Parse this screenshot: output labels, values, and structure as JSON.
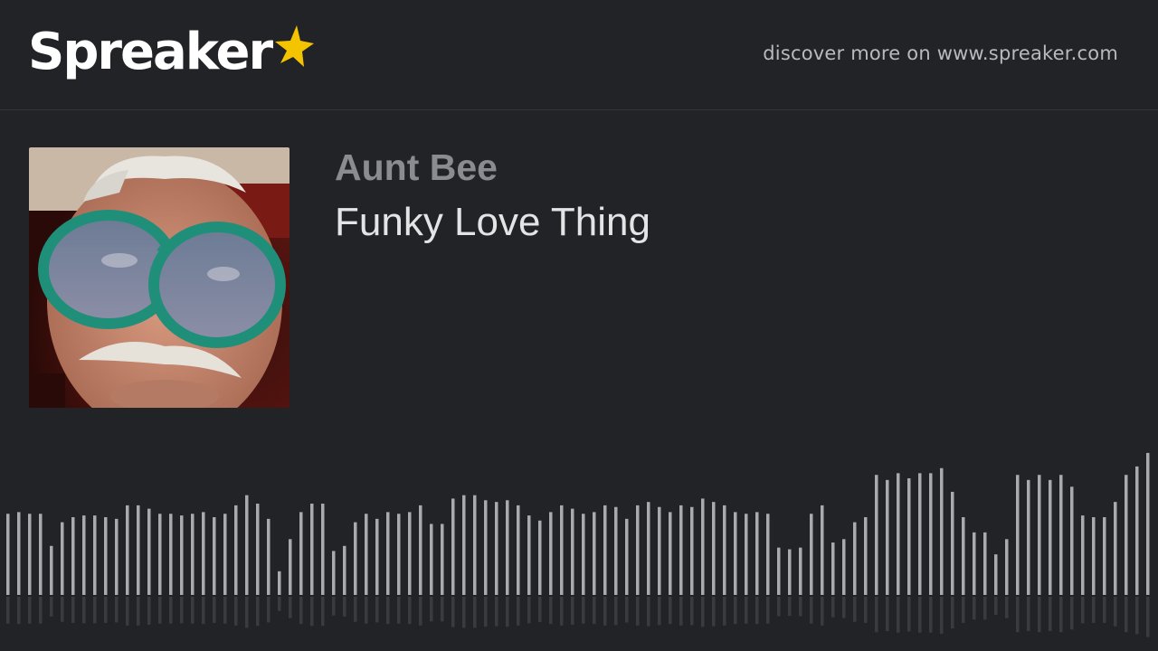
{
  "header": {
    "logo_text": "Spreaker",
    "logo_icon": "star-icon",
    "discover_text": "discover more on www.spreaker.com"
  },
  "episode": {
    "show_title": "Aunt Bee",
    "title": "Funky Love Thing",
    "cover_alt": "podcast-cover-art"
  },
  "waveform": {
    "levels": [
      0.48,
      0.49,
      0.48,
      0.48,
      0.29,
      0.43,
      0.46,
      0.47,
      0.47,
      0.46,
      0.45,
      0.53,
      0.53,
      0.51,
      0.48,
      0.48,
      0.47,
      0.48,
      0.49,
      0.46,
      0.48,
      0.53,
      0.59,
      0.54,
      0.45,
      0.14,
      0.33,
      0.49,
      0.54,
      0.54,
      0.26,
      0.29,
      0.43,
      0.48,
      0.45,
      0.49,
      0.48,
      0.49,
      0.53,
      0.42,
      0.42,
      0.57,
      0.59,
      0.59,
      0.56,
      0.55,
      0.56,
      0.53,
      0.47,
      0.44,
      0.49,
      0.53,
      0.51,
      0.48,
      0.49,
      0.53,
      0.52,
      0.45,
      0.53,
      0.55,
      0.52,
      0.49,
      0.53,
      0.52,
      0.57,
      0.55,
      0.53,
      0.49,
      0.48,
      0.49,
      0.48,
      0.28,
      0.27,
      0.28,
      0.48,
      0.53,
      0.31,
      0.33,
      0.43,
      0.46,
      0.71,
      0.68,
      0.72,
      0.69,
      0.72,
      0.72,
      0.75,
      0.61,
      0.46,
      0.37,
      0.37,
      0.24,
      0.33,
      0.71,
      0.68,
      0.71,
      0.68,
      0.71,
      0.64,
      0.47,
      0.46,
      0.46,
      0.55,
      0.71,
      0.76,
      0.84
    ],
    "accent": "#a9aaad"
  },
  "colors": {
    "background": "#222327",
    "star": "#f5c400"
  }
}
